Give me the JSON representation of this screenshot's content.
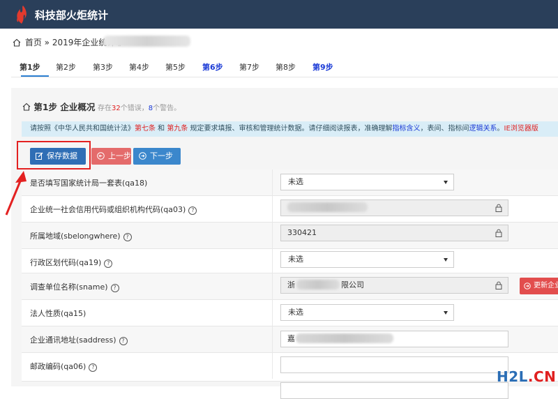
{
  "header": {
    "title": "科技部火炬统计"
  },
  "breadcrumb": {
    "home": "首页",
    "sep": "»",
    "crumb1": "2019年企业统计",
    "crumb2_tail": "》"
  },
  "steps": [
    "第1步",
    "第2步",
    "第3步",
    "第4步",
    "第5步",
    "第6步",
    "第7步",
    "第8步",
    "第9步"
  ],
  "panel": {
    "title": "第1步 企业概况",
    "status_prefix": "存在",
    "error_count": "32",
    "status_mid": "个错误，",
    "warning_count": "8",
    "status_suffix": "个警告。"
  },
  "notice": {
    "t1": "请按照《中华人民共和国统计法》",
    "r1": "第七条",
    "t2": " 和 ",
    "r2": "第九条",
    "t3": " 规定要求填报、审核和管理统计数据。请仔细阅读报表，准确理解",
    "b1": "指标含义",
    "t4": "，表间、指标间",
    "b2": "逻辑关系",
    "t5": "。",
    "r3": "IE浏览器版"
  },
  "buttons": {
    "save": "保存数据",
    "prev": "上一步",
    "next": "下一步",
    "update": "更新企业"
  },
  "fields": [
    {
      "label": "是否填写国家统计局一套表(qa18)",
      "value": "未选"
    },
    {
      "label": "企业统一社会信用代码或组织机构代码(qa03)",
      "value": ""
    },
    {
      "label": "所属地域(sbelongwhere)",
      "value": "330421"
    },
    {
      "label": "行政区划代码(qa19)",
      "value": "未选"
    },
    {
      "label": "调查单位名称(sname)",
      "value_start": "浙",
      "value_end": "限公司"
    },
    {
      "label": "法人性质(qa15)",
      "value": "未选"
    },
    {
      "label": "企业通讯地址(saddress)",
      "value": "嘉"
    },
    {
      "label": "邮政编码(qa06)",
      "value": ""
    }
  ],
  "watermark": {
    "a": "H2L",
    "b": ".CN"
  }
}
